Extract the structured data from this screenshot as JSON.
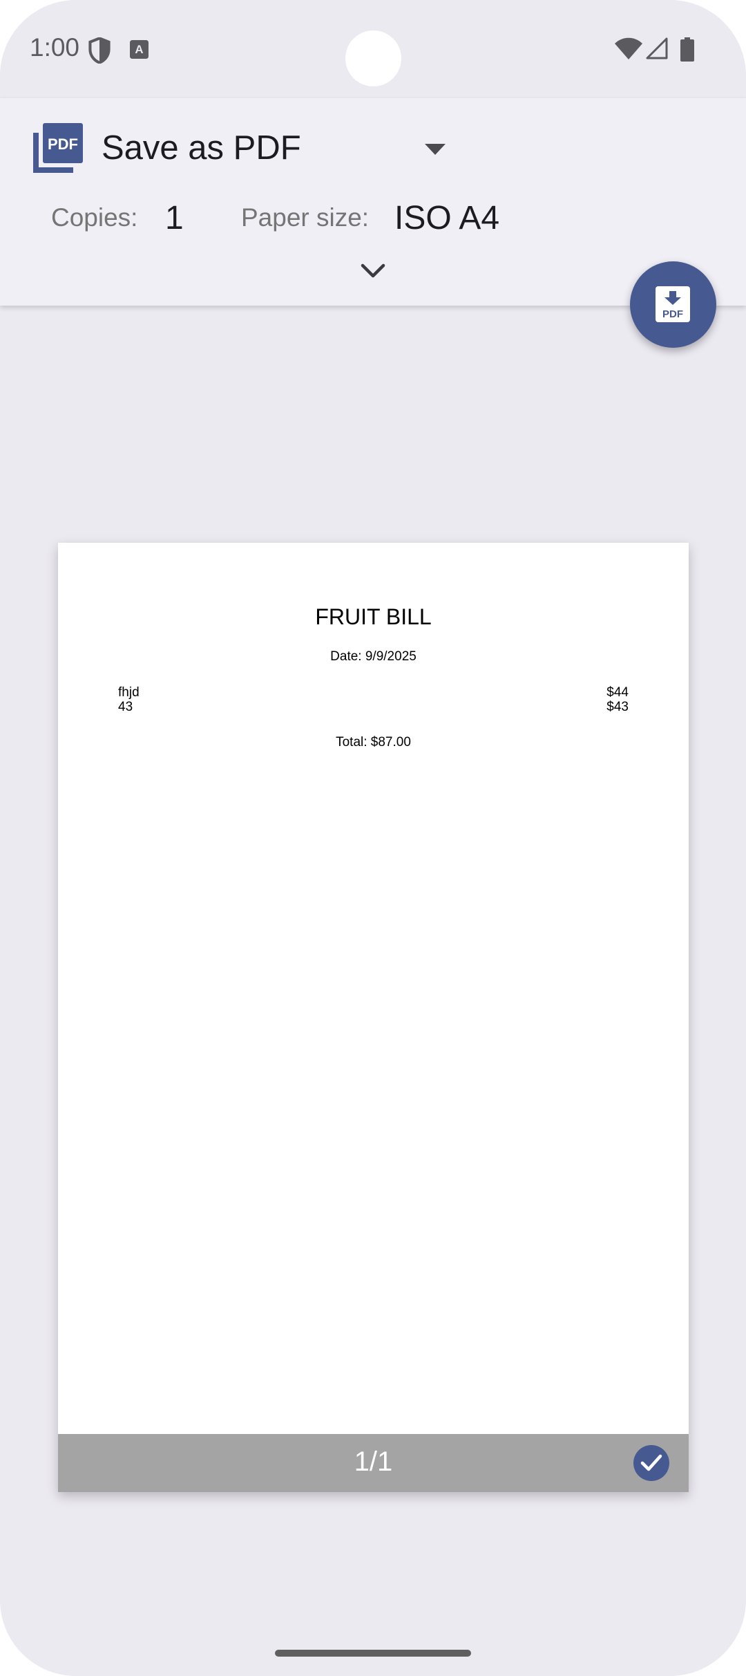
{
  "status_bar": {
    "time": "1:00",
    "icons": [
      "shield-icon",
      "text-a-icon",
      "wifi-icon",
      "signal-icon",
      "battery-icon"
    ]
  },
  "header": {
    "printer_name": "Save as PDF",
    "copies_label": "Copies:",
    "copies_value": "1",
    "paper_size_label": "Paper size:",
    "paper_size_value": "ISO A4",
    "icons": [
      "pdf-logo-icon",
      "dropdown-arrow-icon",
      "chevron-down-icon"
    ]
  },
  "fab": {
    "icon": "pdf-download-icon"
  },
  "preview": {
    "title": "FRUIT BILL",
    "date": "Date: 9/9/2025",
    "items": [
      {
        "name": "fhjd",
        "price": "$44"
      },
      {
        "name": "43",
        "price": "$43"
      }
    ],
    "total": "Total: $87.00",
    "page_indicator": "1/1",
    "selected_icon": "check-icon"
  },
  "colors": {
    "accent": "#465a91",
    "background": "#eceaf1",
    "header_bg": "#f1eff6",
    "page_bar": "#a4a4a4"
  }
}
